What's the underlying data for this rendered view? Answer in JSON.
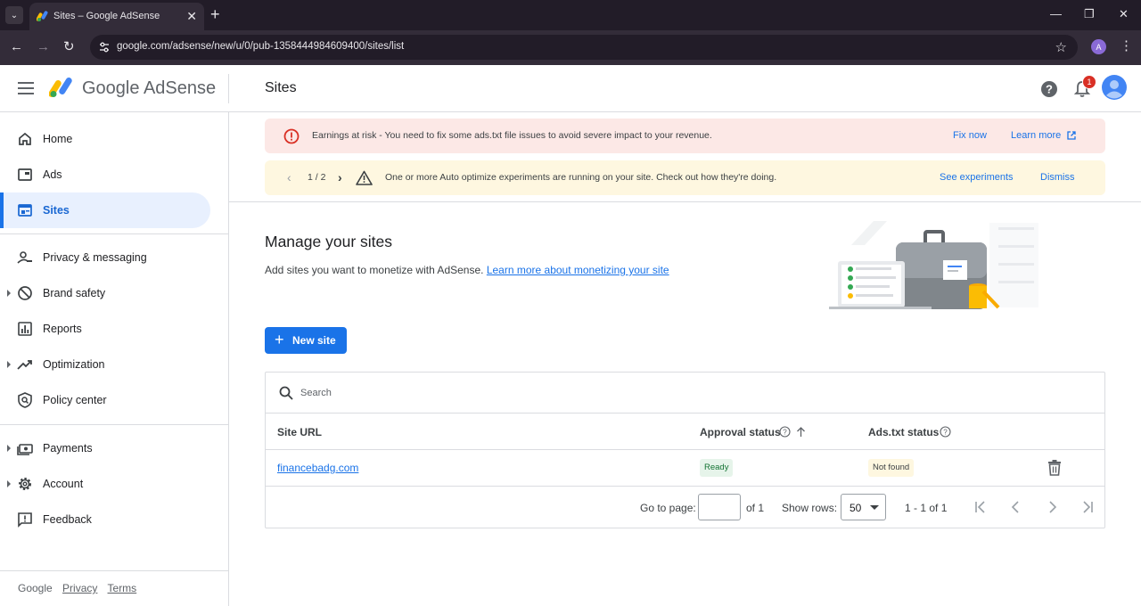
{
  "browser": {
    "tab_title": "Sites – Google AdSense",
    "url": "google.com/adsense/new/u/0/pub-1358444984609400/sites/list",
    "profile_initial": "A",
    "new_tab_glyph": "+",
    "tab_close_glyph": "✕",
    "win_minimize": "—",
    "win_maximize": "❐",
    "win_close": "✕"
  },
  "header": {
    "logo_text": "Google AdSense",
    "page_title": "Sites",
    "notification_count": "1"
  },
  "sidebar": {
    "items": [
      {
        "label": "Home",
        "icon": "home-icon"
      },
      {
        "label": "Ads",
        "icon": "ads-icon"
      },
      {
        "label": "Sites",
        "icon": "sites-icon",
        "active": true
      },
      {
        "label": "Privacy & messaging",
        "icon": "privacy-icon"
      },
      {
        "label": "Brand safety",
        "icon": "block-icon",
        "expandable": true
      },
      {
        "label": "Reports",
        "icon": "reports-icon"
      },
      {
        "label": "Optimization",
        "icon": "trending-icon",
        "expandable": true
      },
      {
        "label": "Policy center",
        "icon": "policy-icon"
      },
      {
        "label": "Payments",
        "icon": "payments-icon",
        "expandable": true
      },
      {
        "label": "Account",
        "icon": "gear-icon",
        "expandable": true
      },
      {
        "label": "Feedback",
        "icon": "feedback-icon"
      }
    ],
    "footer": {
      "brand": "Google",
      "privacy": "Privacy",
      "terms": "Terms"
    }
  },
  "banners": {
    "error": {
      "text": "Earnings at risk - You need to fix some ads.txt file issues to avoid severe impact to your revenue.",
      "fix_now": "Fix now",
      "learn_more": "Learn more"
    },
    "info": {
      "counter": "1 / 2",
      "text": "One or more Auto optimize experiments are running on your site. Check out how they're doing.",
      "see_experiments": "See experiments",
      "dismiss": "Dismiss"
    }
  },
  "main": {
    "title": "Manage your sites",
    "description": "Add sites you want to monetize with AdSense.",
    "description_link": "Learn more about monetizing your site",
    "new_site_label": "New site",
    "search_placeholder": "Search"
  },
  "table": {
    "columns": [
      "Site URL",
      "Approval status",
      "Ads.txt status"
    ],
    "rows": [
      {
        "site_url": "financebadg.com",
        "approval_status": "Ready",
        "ads_txt_status": "Not found"
      }
    ],
    "pager": {
      "go_to_page_label": "Go to page:",
      "of_pages": "of 1",
      "show_rows_label": "Show rows:",
      "rows_value": "50",
      "range": "1 - 1 of 1"
    }
  },
  "colors": {
    "accent": "#1a73e8",
    "error_bg": "#fce8e6",
    "warning_bg": "#fef7e0",
    "active_nav_bg": "#e8f0fe"
  }
}
